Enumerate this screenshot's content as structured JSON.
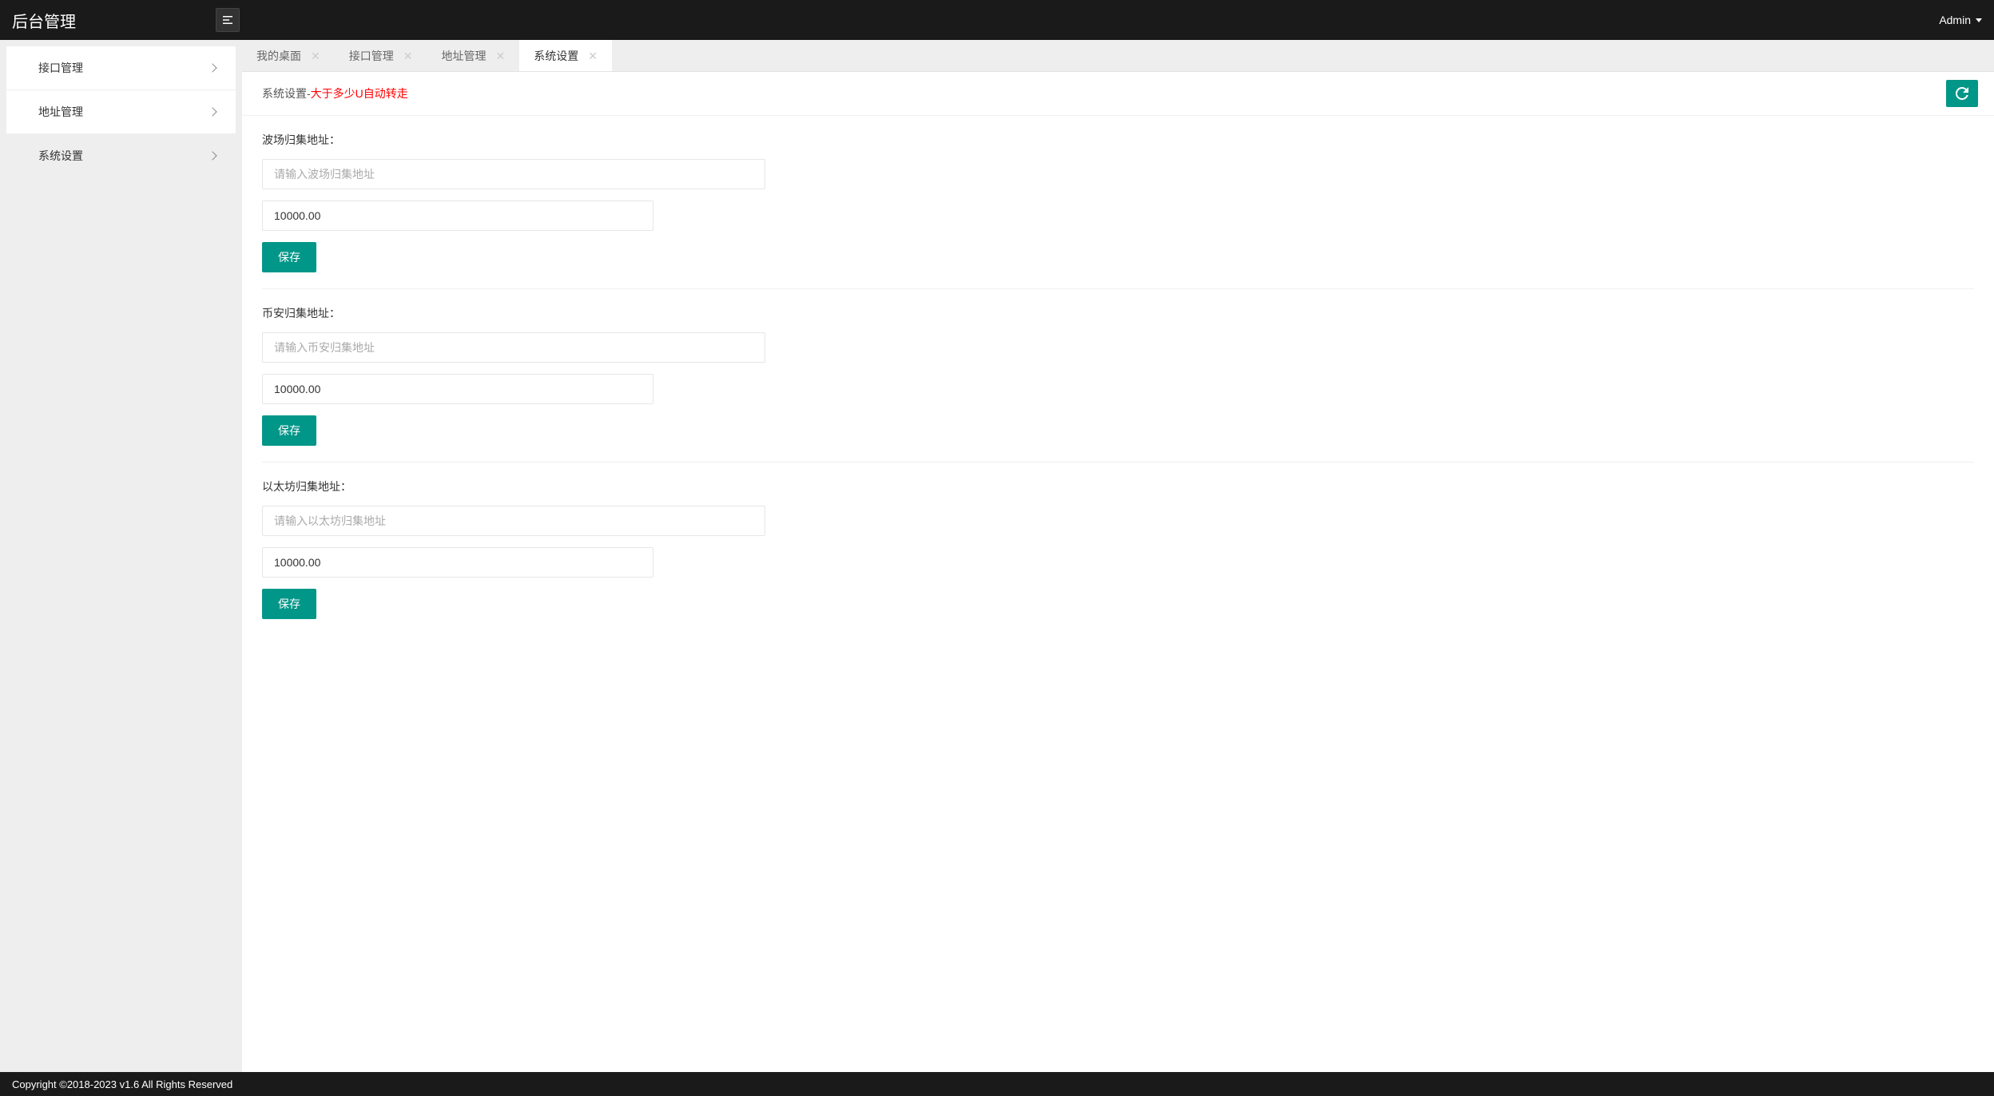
{
  "header": {
    "title": "后台管理",
    "user": "Admin"
  },
  "sidebar": {
    "items": [
      {
        "label": "接口管理"
      },
      {
        "label": "地址管理"
      },
      {
        "label": "系统设置"
      }
    ]
  },
  "tabs": [
    {
      "label": "我的桌面",
      "active": false
    },
    {
      "label": "接口管理",
      "active": false
    },
    {
      "label": "地址管理",
      "active": false
    },
    {
      "label": "系统设置",
      "active": true
    }
  ],
  "breadcrumb": {
    "prefix": "系统设置-",
    "highlight": "大于多少U自动转走"
  },
  "form": {
    "sections": [
      {
        "label": "波场归集地址：",
        "address_placeholder": "请输入波场归集地址",
        "address_value": "",
        "amount_value": "10000.00",
        "save_label": "保存"
      },
      {
        "label": "币安归集地址：",
        "address_placeholder": "请输入币安归集地址",
        "address_value": "",
        "amount_value": "10000.00",
        "save_label": "保存"
      },
      {
        "label": "以太坊归集地址：",
        "address_placeholder": "请输入以太坊归集地址",
        "address_value": "",
        "amount_value": "10000.00",
        "save_label": "保存"
      }
    ]
  },
  "footer": {
    "text": "Copyright ©2018-2023 v1.6 All Rights Reserved"
  }
}
